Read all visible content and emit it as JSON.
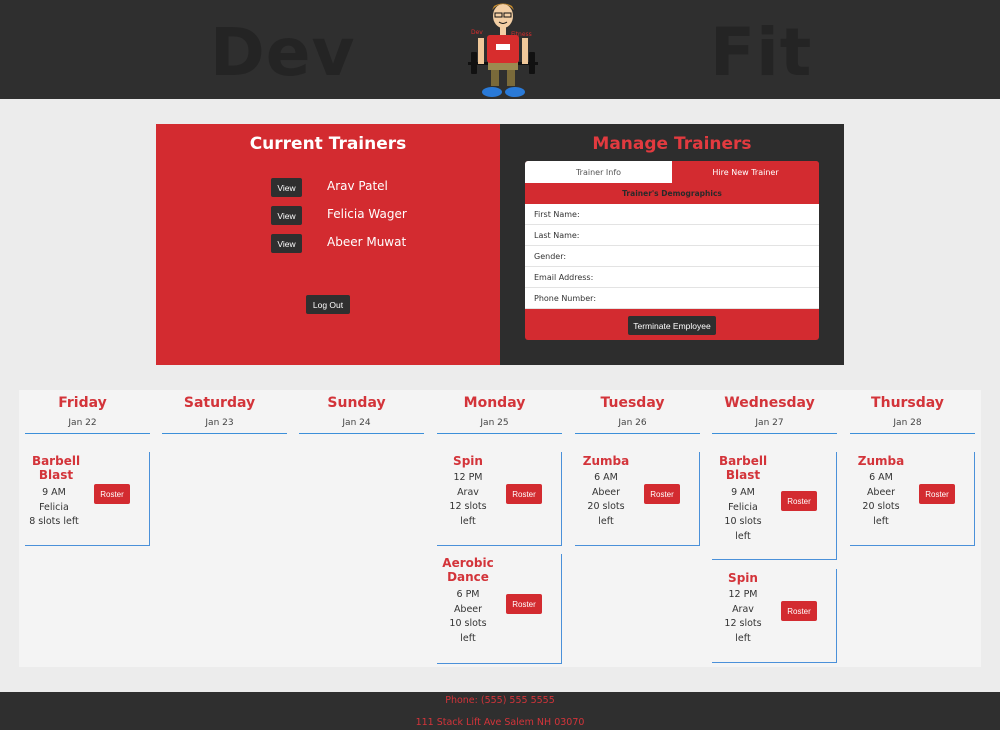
{
  "header": {
    "brand_left": "Dev",
    "brand_right": "Fit",
    "logo_text_left": "Dev",
    "logo_text_right": "Fitness"
  },
  "current_trainers": {
    "title": "Current Trainers",
    "view_label": "View",
    "trainers": [
      "Arav Patel",
      "Felicia Wager",
      "Abeer Muwat"
    ],
    "logout_label": "Log Out"
  },
  "manage_trainers": {
    "title": "Manage Trainers",
    "tabs": [
      "Trainer Info",
      "Hire New Trainer"
    ],
    "section_heading": "Trainer's Demographics",
    "fields": [
      "First Name:",
      "Last Name:",
      "Gender:",
      "Email Address:",
      "Phone Number:"
    ],
    "terminate_label": "Terminate Employee"
  },
  "schedule": {
    "roster_label": "Roster",
    "days": [
      {
        "name": "Friday",
        "date": "Jan 22",
        "classes": [
          {
            "name": [
              "Barbell",
              "Blast"
            ],
            "info": [
              "9 AM",
              "Felicia",
              "8 slots left"
            ]
          }
        ]
      },
      {
        "name": "Saturday",
        "date": "Jan 23",
        "classes": []
      },
      {
        "name": "Sunday",
        "date": "Jan 24",
        "classes": []
      },
      {
        "name": "Monday",
        "date": "Jan 25",
        "classes": [
          {
            "name": [
              "Spin"
            ],
            "info": [
              "12 PM",
              "Arav",
              "12 slots",
              "left"
            ]
          },
          {
            "name": [
              "Aerobic",
              "Dance"
            ],
            "info": [
              "6 PM",
              "Abeer",
              "10 slots",
              "left"
            ]
          }
        ]
      },
      {
        "name": "Tuesday",
        "date": "Jan 26",
        "classes": [
          {
            "name": [
              "Zumba"
            ],
            "info": [
              "6 AM",
              "Abeer",
              "20 slots",
              "left"
            ]
          }
        ]
      },
      {
        "name": "Wednesday",
        "date": "Jan 27",
        "classes": [
          {
            "name": [
              "Barbell",
              "Blast"
            ],
            "info": [
              "9 AM",
              "Felicia",
              "10 slots",
              "left"
            ]
          },
          {
            "name": [
              "Spin"
            ],
            "info": [
              "12 PM",
              "Arav",
              "12 slots",
              "left"
            ]
          }
        ]
      },
      {
        "name": "Thursday",
        "date": "Jan 28",
        "classes": [
          {
            "name": [
              "Zumba"
            ],
            "info": [
              "6 AM",
              "Abeer",
              "20 slots",
              "left"
            ]
          }
        ]
      }
    ]
  },
  "footer": {
    "phone": "Phone: (555) 555 5555",
    "address": "111 Stack Lift Ave Salem NH 03070"
  },
  "colors": {
    "accent_red": "#d32b30",
    "dark": "#2f2f2f",
    "divider_blue": "#3c8fd9"
  }
}
